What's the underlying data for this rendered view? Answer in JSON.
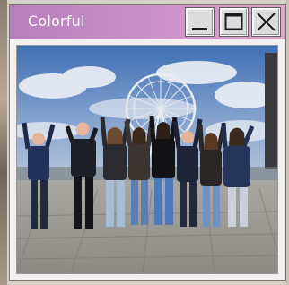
{
  "window": {
    "title": "Colorful",
    "controls": {
      "minimize": "minimize-icon",
      "maximize": "maximize-icon",
      "close": "close-icon"
    },
    "accent_gradient": [
      "#b67fbd",
      "#e0a6c5"
    ]
  },
  "content": {
    "image": "group-photo-ferris-wheel"
  }
}
